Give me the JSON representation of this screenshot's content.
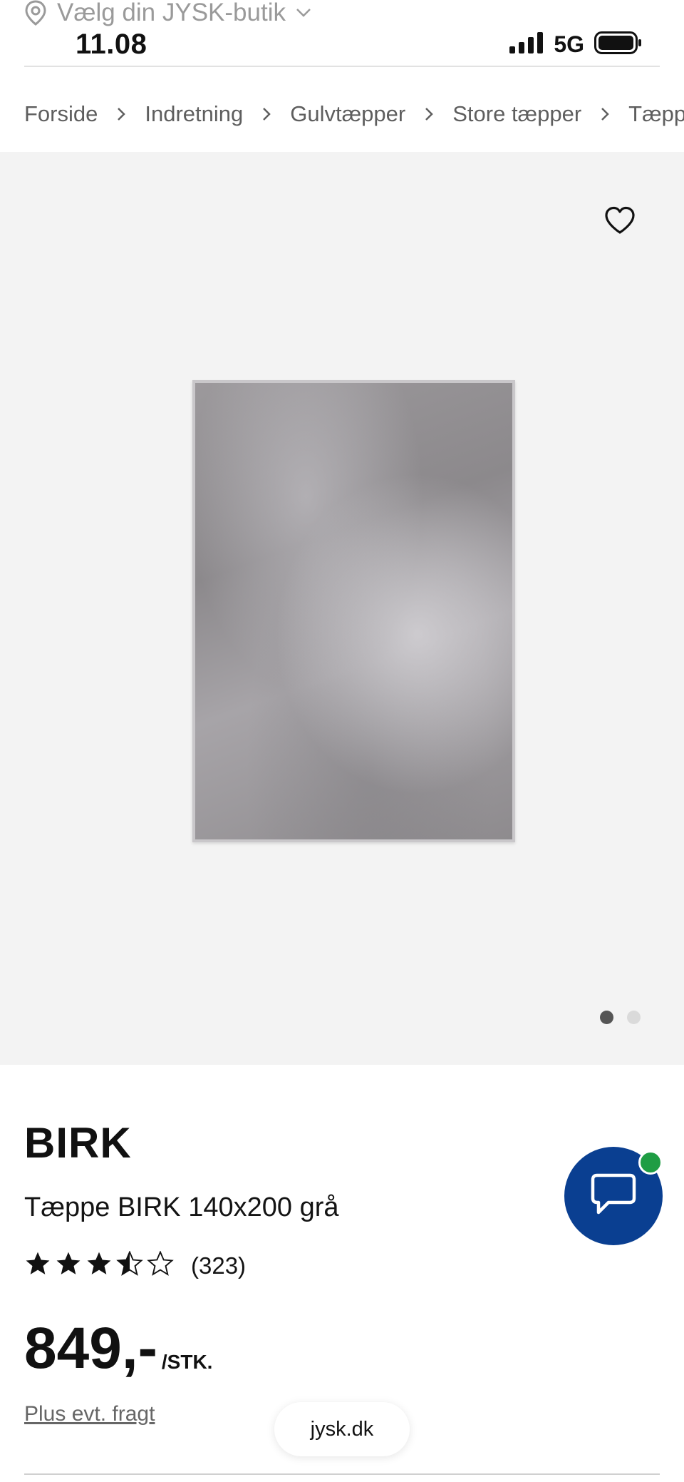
{
  "store_selector": {
    "label": "Vælg din JYSK-butik",
    "icon": "location-pin-icon"
  },
  "status_bar": {
    "time": "11.08",
    "network": "5G"
  },
  "breadcrumbs": [
    "Forside",
    "Indretning",
    "Gulvtæpper",
    "Store tæpper",
    "Tæpper"
  ],
  "gallery": {
    "image_count": 2,
    "active_index": 0
  },
  "product": {
    "brand": "BIRK",
    "title": "Tæppe BIRK 140x200 grå",
    "rating_value": 3.5,
    "rating_max": 5,
    "rating_count": "(323)",
    "price": "849,-",
    "price_unit": "/STK.",
    "freight_link": "Plus evt. fragt"
  },
  "browser": {
    "url": "jysk.dk"
  },
  "colors": {
    "chat_button": "#0a3f91",
    "chat_status": "#1f9d44",
    "gallery_bg": "#f3f3f3"
  }
}
